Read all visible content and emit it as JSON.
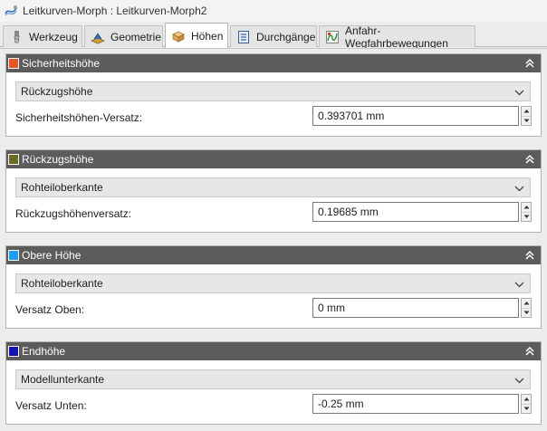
{
  "window": {
    "title": "Leitkurven-Morph : Leitkurven-Morph2"
  },
  "tabs": [
    {
      "label": "Werkzeug",
      "icon": "tool-icon",
      "active": false
    },
    {
      "label": "Geometrie",
      "icon": "geometry-icon",
      "active": false
    },
    {
      "label": "Höhen",
      "icon": "heights-icon",
      "active": true
    },
    {
      "label": "Durchgänge",
      "icon": "passes-icon",
      "active": false
    },
    {
      "label": "Anfahr-Wegfahrbewegungen",
      "icon": "linking-icon",
      "active": false
    }
  ],
  "panels": [
    {
      "title": "Sicherheitshöhe",
      "color": "#e8562a",
      "dropdown": "Rückzugshöhe",
      "field_label": "Sicherheitshöhen-Versatz:",
      "value": "0.393701 mm"
    },
    {
      "title": "Rückzugshöhe",
      "color": "#6b6b23",
      "dropdown": "Rohteiloberkante",
      "field_label": "Rückzugshöhenversatz:",
      "value": "0.19685 mm"
    },
    {
      "title": "Obere Höhe",
      "color": "#1e9ef0",
      "dropdown": "Rohteiloberkante",
      "field_label": "Versatz Oben:",
      "value": "0 mm"
    },
    {
      "title": "Endhöhe",
      "color": "#1414b4",
      "dropdown": "Modellunterkante",
      "field_label": "Versatz Unten:",
      "value": "-0.25 mm"
    }
  ]
}
